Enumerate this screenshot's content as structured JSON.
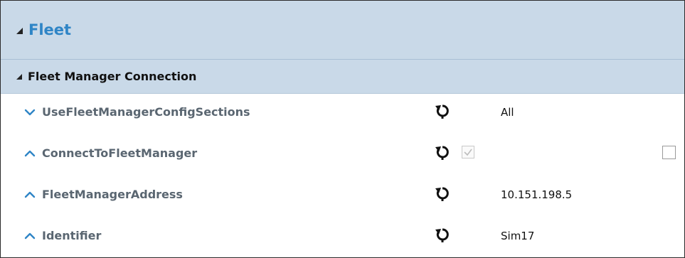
{
  "category": {
    "label": "Fleet",
    "expanded": true,
    "title_color": "#2f85c6"
  },
  "section": {
    "label": "Fleet Manager Connection",
    "expanded": true
  },
  "colors": {
    "header_bg": "#c9d9e8",
    "chevron": "#2f85c6",
    "name_text": "#5a6671"
  },
  "rows": [
    {
      "name": "UseFleetManagerConfigSections",
      "chevron": "chevron-down-icon",
      "value": "All"
    },
    {
      "name": "ConnectToFleetManager",
      "chevron": "chevron-up-icon",
      "default_checked": true,
      "checked": false
    },
    {
      "name": "FleetManagerAddress",
      "chevron": "chevron-up-icon",
      "value": "10.151.198.5"
    },
    {
      "name": "Identifier",
      "chevron": "chevron-up-icon",
      "value": "Sim17"
    }
  ]
}
